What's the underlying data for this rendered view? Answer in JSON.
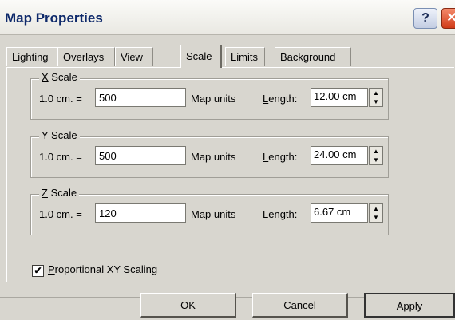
{
  "window": {
    "title": "Map Properties",
    "help_glyph": "?",
    "close_glyph": "✕"
  },
  "tabs": [
    {
      "label": "Lighting"
    },
    {
      "label": "Overlays"
    },
    {
      "label": "View"
    },
    {
      "label": "Scale",
      "active": true
    },
    {
      "label": "Limits"
    },
    {
      "label": "Background"
    }
  ],
  "scales": [
    {
      "axis": "X",
      "legend_rest": " Scale",
      "ratio_label": "1.0 cm. =",
      "value": "500",
      "units": "Map units",
      "length_label_first": "L",
      "length_label_rest": "ength:",
      "length": "12.00 cm"
    },
    {
      "axis": "Y",
      "legend_rest": " Scale",
      "ratio_label": "1.0 cm. =",
      "value": "500",
      "units": "Map units",
      "length_label_first": "L",
      "length_label_rest": "ength:",
      "length": "24.00 cm"
    },
    {
      "axis": "Z",
      "legend_rest": " Scale",
      "ratio_label": "1.0 cm. =",
      "value": "120",
      "units": "Map units",
      "length_label_first": "L",
      "length_label_rest": "ength:",
      "length": "6.67 cm"
    }
  ],
  "proportional": {
    "checked": true,
    "label_first": "P",
    "label_rest": "roportional XY Scaling",
    "check_glyph": "✔"
  },
  "buttons": {
    "ok": "OK",
    "cancel": "Cancel",
    "apply": "Apply"
  },
  "colors": {
    "title_text": "#0f2a6b",
    "close_button": "#d03b18"
  }
}
